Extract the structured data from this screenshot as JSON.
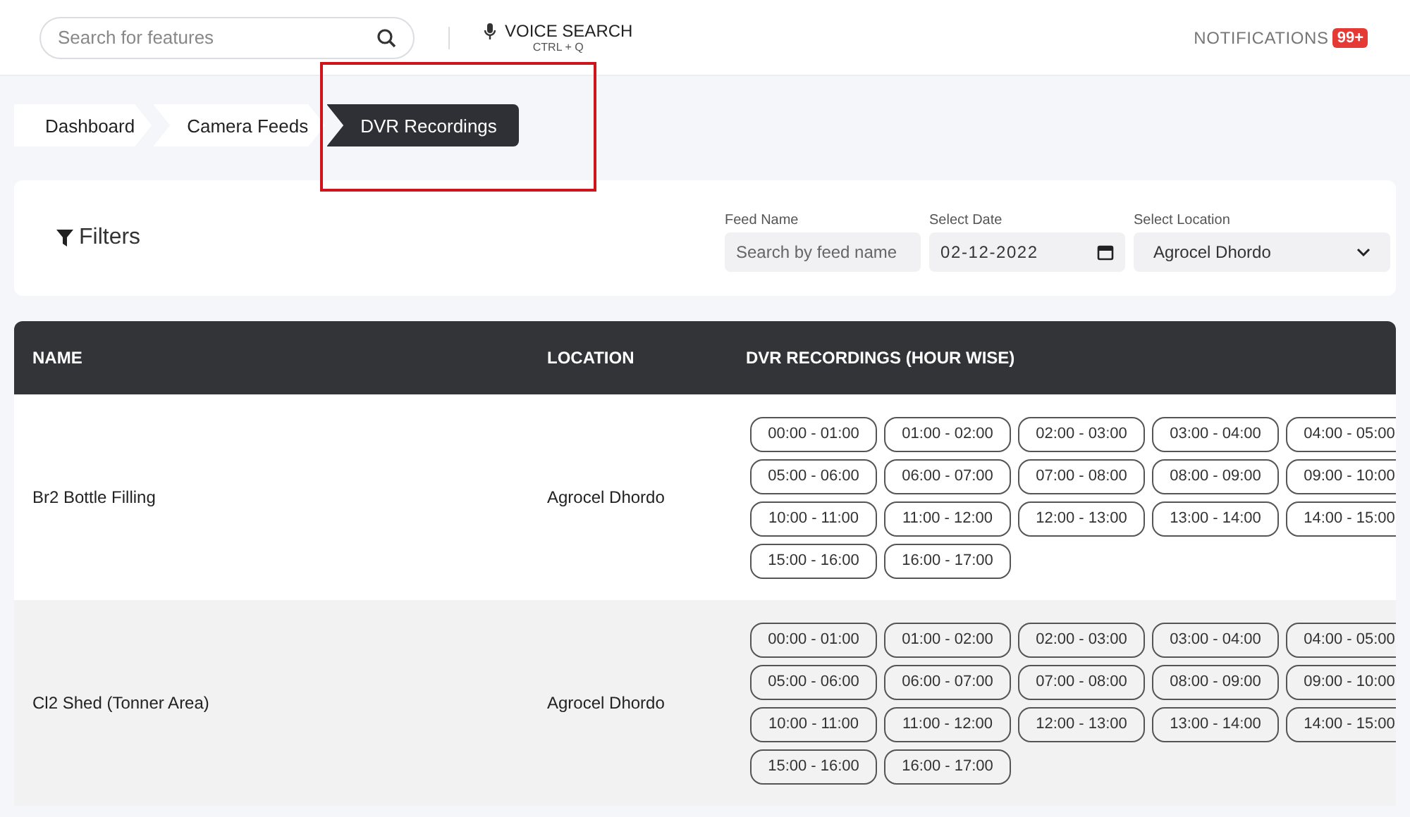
{
  "header": {
    "search": {
      "placeholder": "Search for features"
    },
    "voice_search": {
      "label": "VOICE SEARCH",
      "shortcut": "CTRL + Q"
    },
    "notifications": {
      "label": "NOTIFICATIONS",
      "count": "99+"
    }
  },
  "breadcrumb": [
    {
      "label": "Dashboard",
      "selected": false
    },
    {
      "label": "Camera Feeds",
      "selected": false
    },
    {
      "label": "DVR Recordings",
      "selected": true
    }
  ],
  "filters": {
    "title": "Filters",
    "fields": [
      {
        "kind": "text",
        "label": "Feed Name",
        "placeholder": "Search by feed name"
      },
      {
        "kind": "date",
        "label": "Select Date",
        "value": "02-12-2022"
      },
      {
        "kind": "select",
        "label": "Select Location",
        "value": "Agrocel Dhordo"
      }
    ]
  },
  "table": {
    "columns": [
      "NAME",
      "LOCATION",
      "DVR RECORDINGS (HOUR WISE)"
    ],
    "rows": [
      {
        "name": "Br2 Bottle Filling",
        "location": "Agrocel Dhordo",
        "recordings": [
          "00:00 - 01:00",
          "01:00 - 02:00",
          "02:00 - 03:00",
          "03:00 - 04:00",
          "04:00 - 05:00",
          "05:00 - 06:00",
          "06:00 - 07:00",
          "07:00 - 08:00",
          "08:00 - 09:00",
          "09:00 - 10:00",
          "10:00 - 11:00",
          "11:00 - 12:00",
          "12:00 - 13:00",
          "13:00 - 14:00",
          "14:00 - 15:00",
          "15:00 - 16:00",
          "16:00 - 17:00"
        ]
      },
      {
        "name": "Cl2 Shed (Tonner Area)",
        "location": "Agrocel Dhordo",
        "recordings": [
          "00:00 - 01:00",
          "01:00 - 02:00",
          "02:00 - 03:00",
          "03:00 - 04:00",
          "04:00 - 05:00",
          "05:00 - 06:00",
          "06:00 - 07:00",
          "07:00 - 08:00",
          "08:00 - 09:00",
          "09:00 - 10:00",
          "10:00 - 11:00",
          "11:00 - 12:00",
          "12:00 - 13:00",
          "13:00 - 14:00",
          "14:00 - 15:00",
          "15:00 - 16:00",
          "16:00 - 17:00"
        ]
      }
    ]
  }
}
